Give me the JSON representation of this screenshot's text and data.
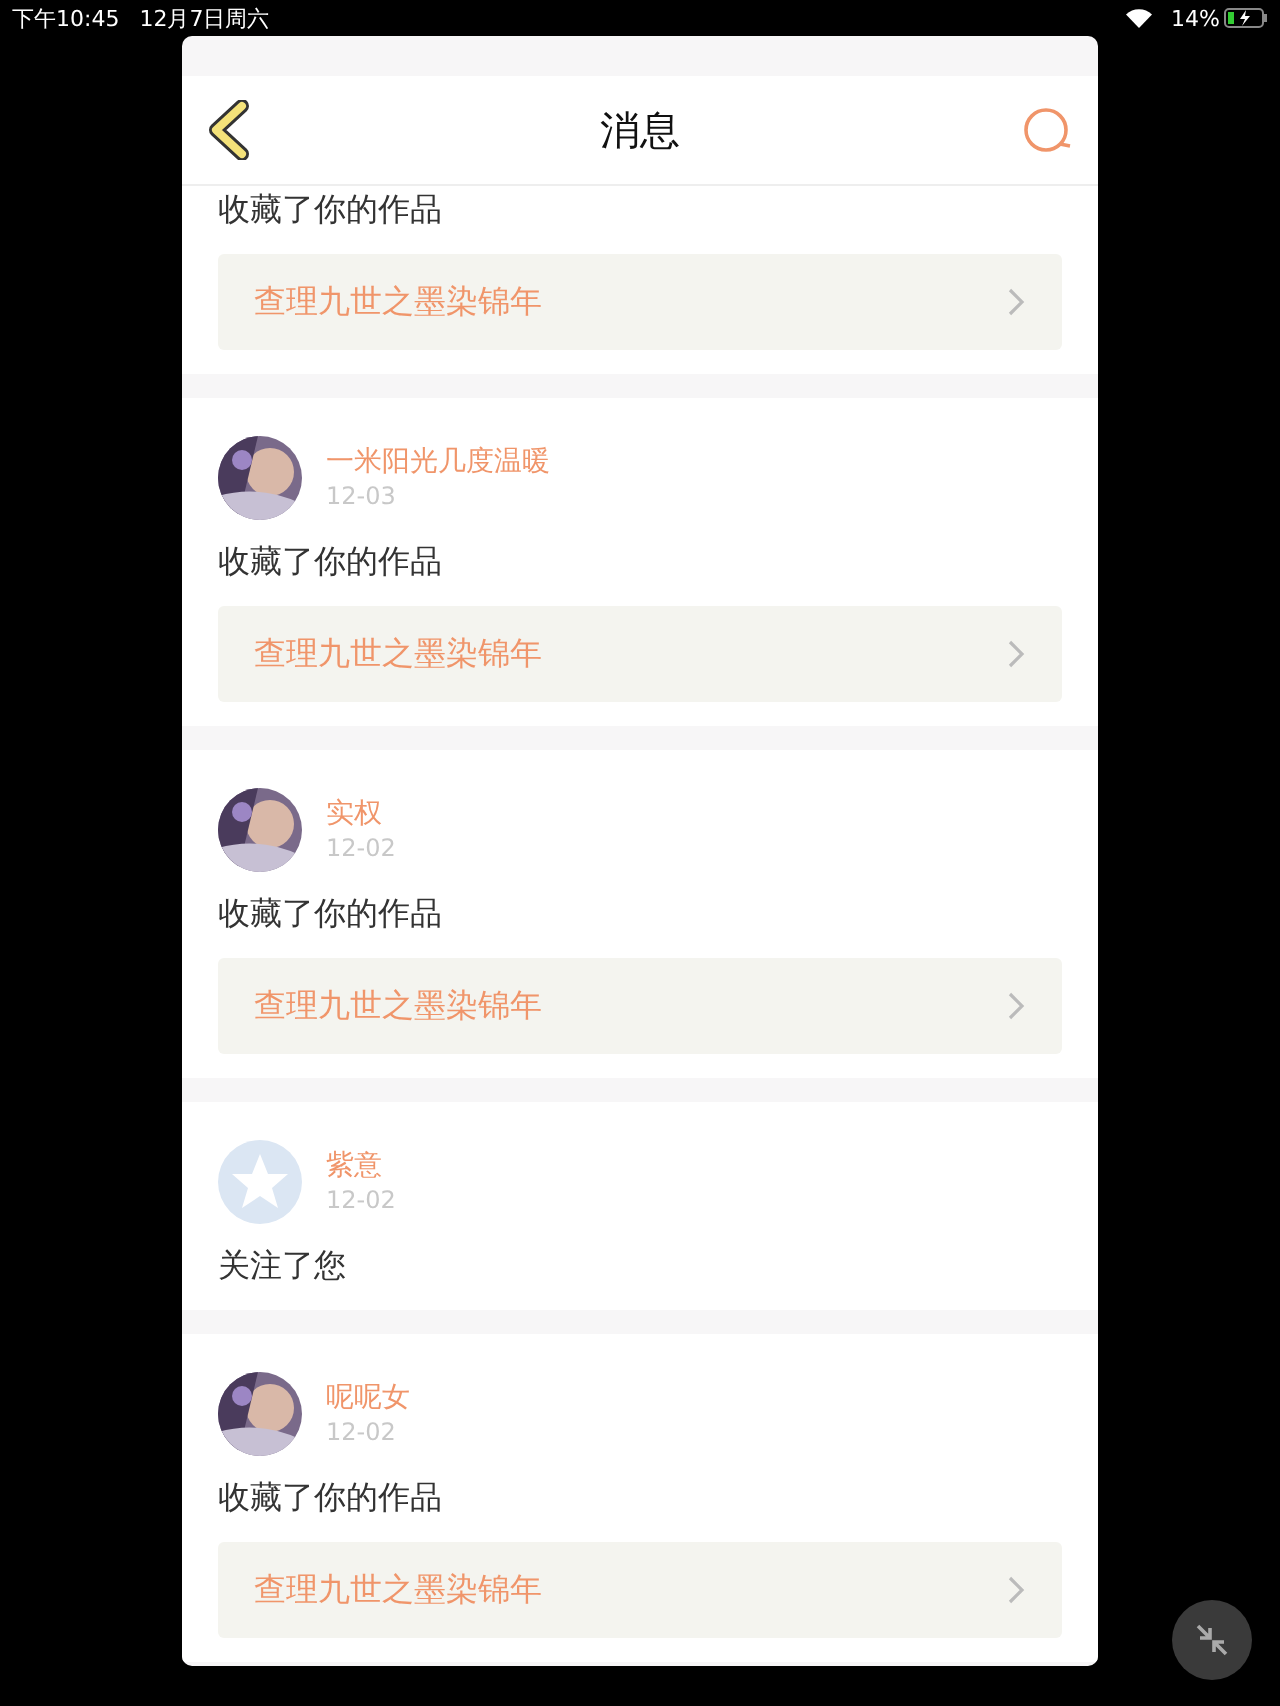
{
  "status_bar": {
    "time": "下午10:45",
    "date": "12月7日周六",
    "battery": "14%"
  },
  "header": {
    "title": "消息"
  },
  "notifications": [
    {
      "action": "收藏了你的作品",
      "work": "查理九世之墨染锦年"
    },
    {
      "user": {
        "name": "一米阳光几度温暖"
      },
      "date": "12-03",
      "action": "收藏了你的作品",
      "work": "查理九世之墨染锦年"
    },
    {
      "user": {
        "name": "实权"
      },
      "date": "12-02",
      "action": "收藏了你的作品",
      "work": "查理九世之墨染锦年"
    },
    {
      "user": {
        "name": "紫意",
        "avatar": {
          "kind": "default"
        }
      },
      "date": "12-02",
      "action": "关注了您"
    },
    {
      "user": {
        "name": "呢呢女"
      },
      "date": "12-02",
      "action": "收藏了你的作品",
      "work": "查理九世之墨染锦年"
    }
  ]
}
